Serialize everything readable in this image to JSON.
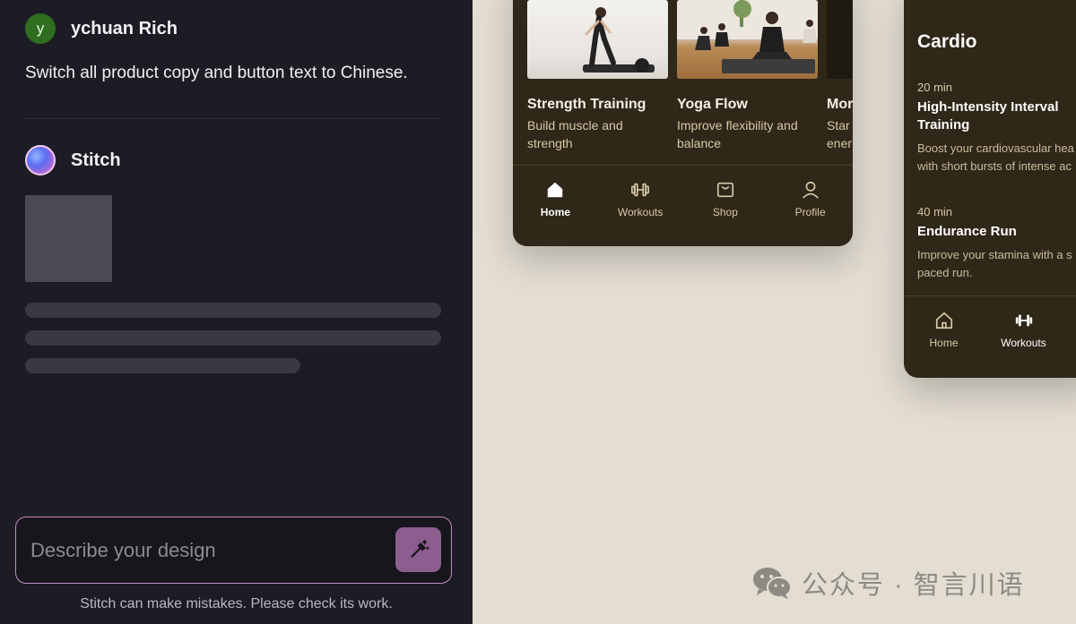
{
  "chat": {
    "user": {
      "initial": "y",
      "name": "ychuan Rich"
    },
    "user_message": "Switch all product copy and button text to Chinese.",
    "assistant": {
      "name": "Stitch"
    },
    "prompt": {
      "placeholder": "Describe your design",
      "value": ""
    },
    "disclaimer": "Stitch can make mistakes. Please check its work."
  },
  "canvas": {
    "phone_a": {
      "cards": [
        {
          "title": "Strength Training",
          "description": "Build muscle and strength"
        },
        {
          "title": "Yoga Flow",
          "description": "Improve flexibility and balance"
        },
        {
          "title": "Mor",
          "description": "Star ener"
        }
      ],
      "nav": [
        {
          "label": "Home",
          "icon": "home-icon",
          "active": true
        },
        {
          "label": "Workouts",
          "icon": "dumbbell-icon",
          "active": false
        },
        {
          "label": "Shop",
          "icon": "shopping-bag-icon",
          "active": false
        },
        {
          "label": "Profile",
          "icon": "person-icon",
          "active": false
        }
      ]
    },
    "phone_b": {
      "section_title": "Cardio",
      "workouts": [
        {
          "duration": "20 min",
          "title": "High-Intensity Interval Training",
          "desc_line1": "Boost your cardiovascular hea",
          "desc_line2": "with short bursts of intense ac"
        },
        {
          "duration": "40 min",
          "title": "Endurance Run",
          "desc_line1": "Improve your stamina with a s",
          "desc_line2": "paced run."
        }
      ],
      "nav": [
        {
          "label": "Home",
          "icon": "home-icon",
          "active": false
        },
        {
          "label": "Workouts",
          "icon": "dumbbell-icon",
          "active": true
        }
      ]
    }
  },
  "watermark": {
    "text": "公众号 · 智言川语",
    "icon": "wechat-icon"
  },
  "colors": {
    "chat_bg": "#1c1c24",
    "canvas_bg": "#e3ddd2",
    "phone_bg": "#2f2718",
    "accent_pink": "#c58ac0",
    "button_purple": "#8c5d8f",
    "user_avatar_green": "#2f6d1f"
  }
}
